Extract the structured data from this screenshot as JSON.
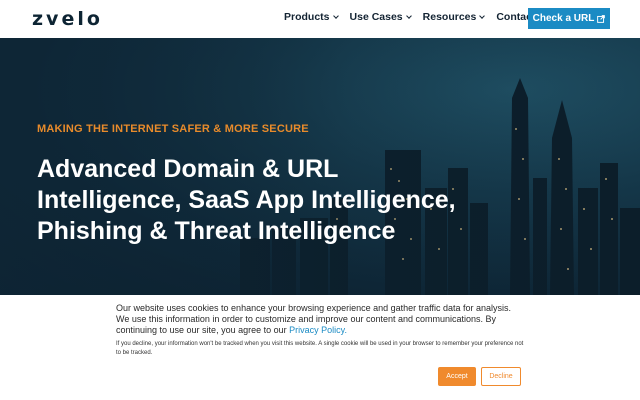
{
  "header": {
    "logo_text": "zvelo",
    "nav": [
      {
        "label": "Products",
        "has_dropdown": true
      },
      {
        "label": "Use Cases",
        "has_dropdown": true
      },
      {
        "label": "Resources",
        "has_dropdown": true
      },
      {
        "label": "Contact Us",
        "has_dropdown": false
      }
    ],
    "cta_label": "Check a URL",
    "cta_icon": "external-link-icon"
  },
  "hero": {
    "tagline": "MAKING THE INTERNET SAFER & MORE SECURE",
    "headline": "Advanced Domain & URL Intelligence, SaaS App Intelligence, Phishing & Threat Intelligence"
  },
  "cookie_banner": {
    "message": "Our website uses cookies to enhance your browsing experience and gather traffic data for analysis. We use this information in order to customize and improve our content and communications. By continuing to use our site, you agree to our",
    "link_text": "Privacy Policy.",
    "decline_note": "If you decline, your information won't be tracked when you visit this website. A single cookie will be used in your browser to remember your preference not to be tracked.",
    "accept_label": "Accept",
    "decline_label": "Decline"
  },
  "colors": {
    "brand_blue": "#1b8bc4",
    "accent_orange": "#e88b2b",
    "hero_bg": "#0e2636",
    "header_text": "#142433"
  }
}
